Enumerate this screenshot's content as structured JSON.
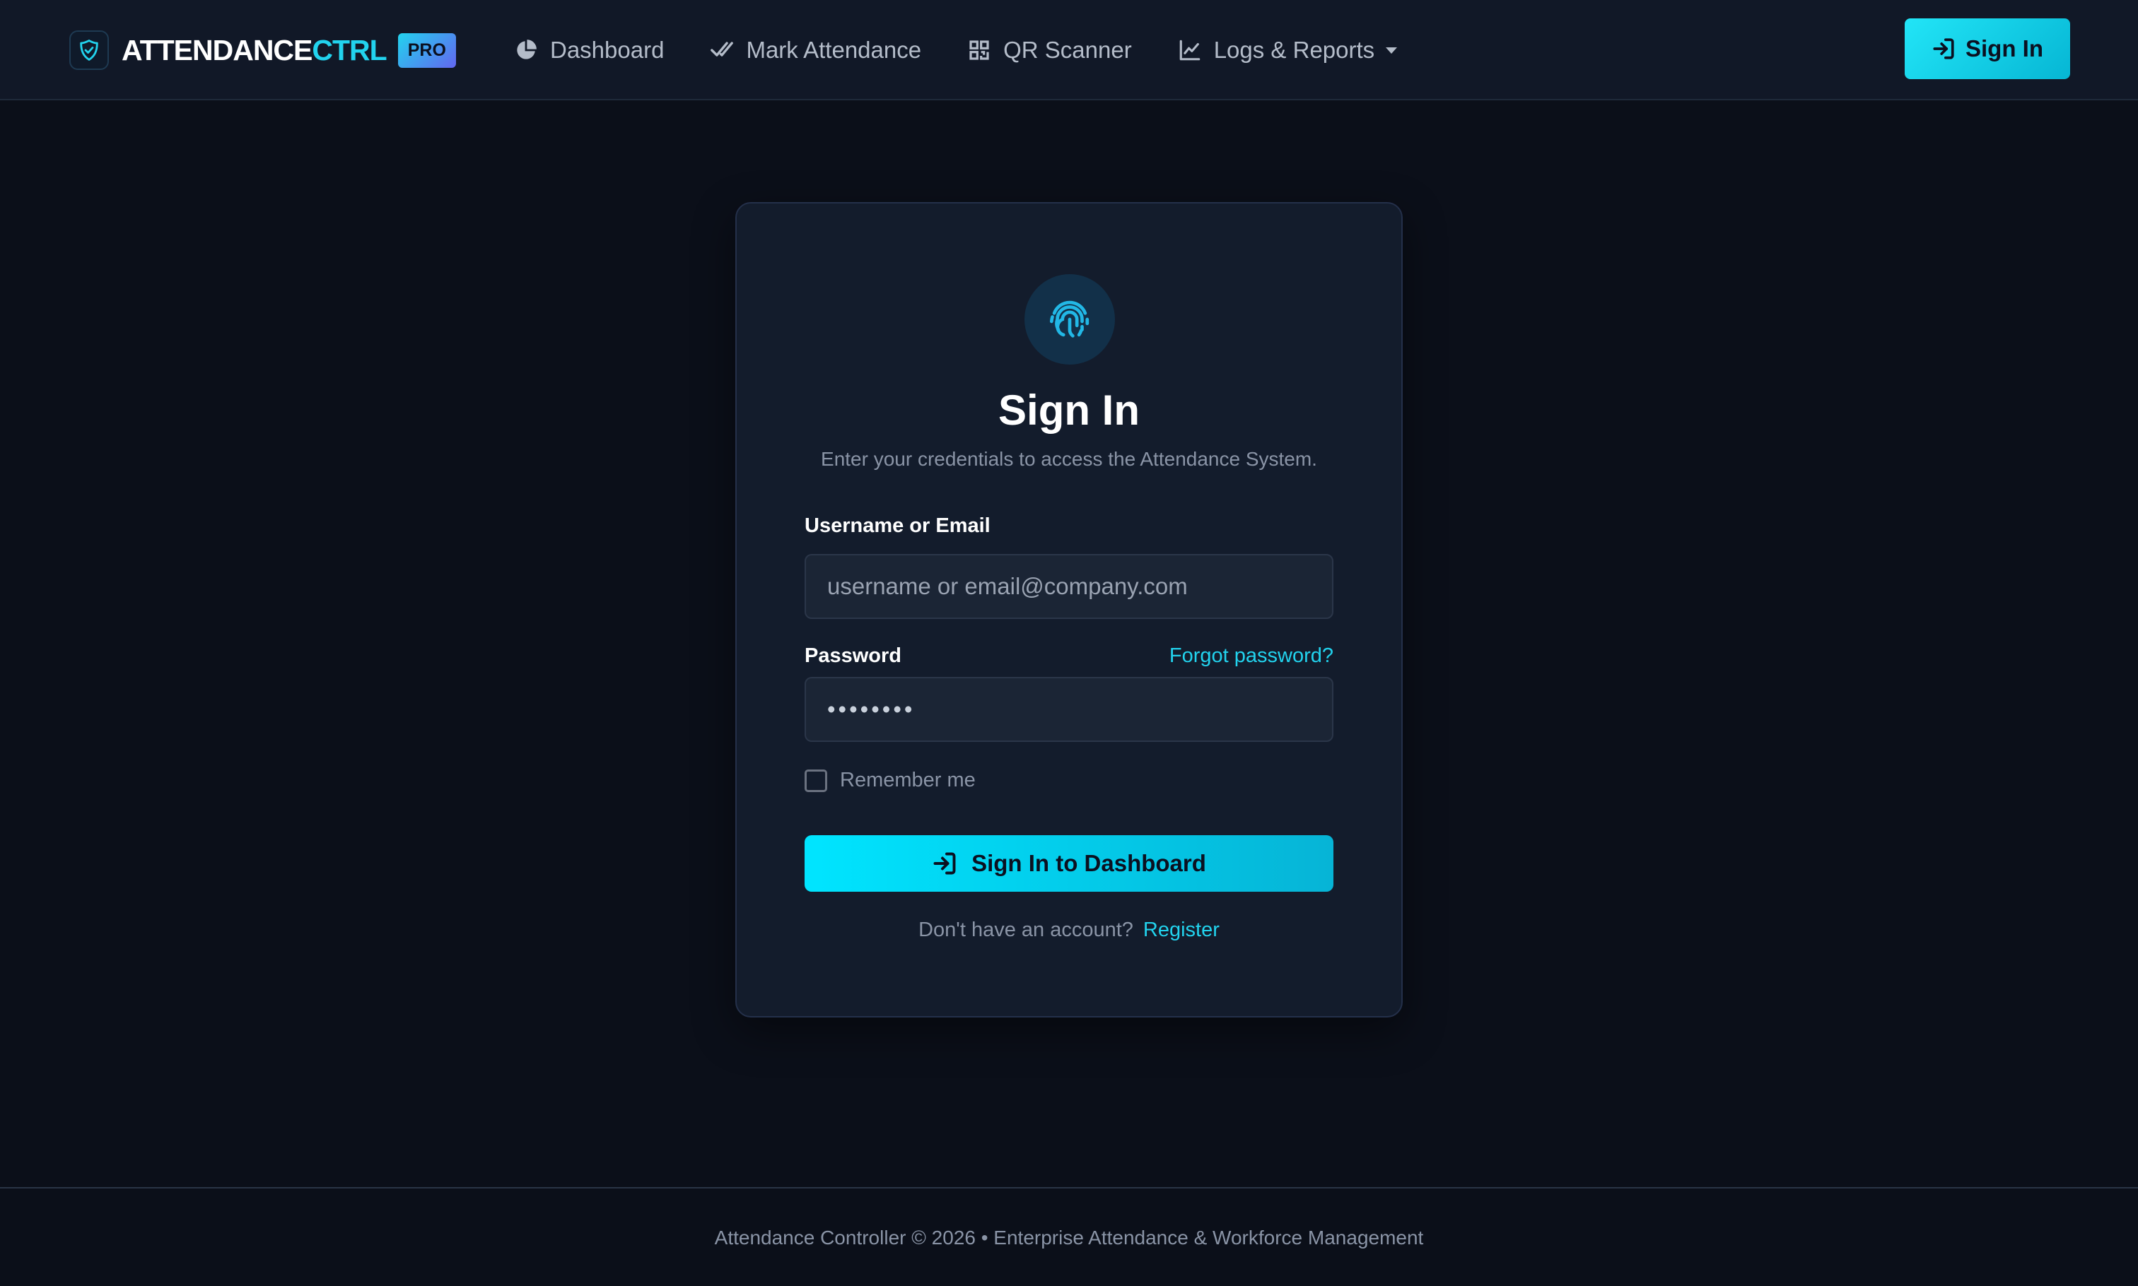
{
  "brand": {
    "name_main": "ATTENDANCE",
    "name_accent": "CTRL",
    "badge": "PRO",
    "logo_icon": "shield-check-icon"
  },
  "nav": {
    "items": [
      {
        "label": "Dashboard",
        "icon": "pie-chart-icon"
      },
      {
        "label": "Mark Attendance",
        "icon": "check-double-icon"
      },
      {
        "label": "QR Scanner",
        "icon": "qr-code-icon"
      },
      {
        "label": "Logs & Reports",
        "icon": "line-chart-icon",
        "dropdown": true
      }
    ],
    "signin_label": "Sign In"
  },
  "card": {
    "icon": "fingerprint-icon",
    "title": "Sign In",
    "subtitle": "Enter your credentials to access the Attendance System.",
    "username_label": "Username or Email",
    "username_placeholder": "username or email@company.com",
    "username_value": "",
    "password_label": "Password",
    "password_value": "••••••••",
    "forgot_label": "Forgot password?",
    "remember_label": "Remember me",
    "remember_checked": false,
    "submit_label": "Sign In to Dashboard",
    "register_prompt": "Don't have an account?",
    "register_link": "Register"
  },
  "footer": {
    "text": "Attendance Controller © 2026 • Enterprise Attendance & Workforce Management"
  },
  "colors": {
    "background": "#0b0f19",
    "navbar": "#111827",
    "card": "#131c2c",
    "accent": "#22d3ee",
    "muted_text": "#8a94a6"
  }
}
